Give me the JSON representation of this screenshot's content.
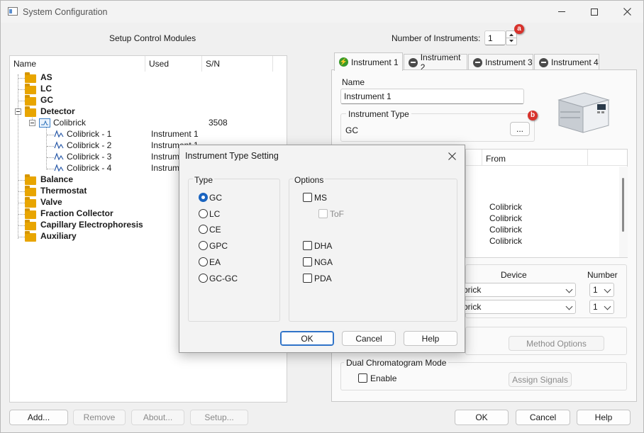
{
  "window": {
    "title": "System Configuration"
  },
  "left": {
    "heading": "Setup Control Modules",
    "columns": [
      "Name",
      "Used",
      "S/N"
    ],
    "tree": [
      {
        "label": "AS",
        "bold": true
      },
      {
        "label": "LC",
        "bold": true
      },
      {
        "label": "GC",
        "bold": true
      },
      {
        "label": "Detector",
        "bold": true
      },
      {
        "label": "Colibrick",
        "sn": "3508"
      },
      {
        "label": "Colibrick - 1",
        "used": "Instrument 1"
      },
      {
        "label": "Colibrick - 2",
        "used": "Instrument 1"
      },
      {
        "label": "Colibrick - 3",
        "used": "Instrume"
      },
      {
        "label": "Colibrick - 4",
        "used": "Instrume"
      },
      {
        "label": "Balance",
        "bold": true
      },
      {
        "label": "Thermostat",
        "bold": true
      },
      {
        "label": "Valve",
        "bold": true
      },
      {
        "label": "Fraction Collector",
        "bold": true
      },
      {
        "label": "Capillary Electrophoresis",
        "bold": true
      },
      {
        "label": "Auxiliary",
        "bold": true
      }
    ],
    "buttons": {
      "add": "Add...",
      "remove": "Remove",
      "about": "About...",
      "setup": "Setup..."
    }
  },
  "right": {
    "num_instruments_label": "Number of Instruments:",
    "num_instruments_value": "1",
    "badge_a": "a",
    "badge_b": "b",
    "tabs": [
      "Instrument 1",
      "Instrument 2",
      "Instrument 3",
      "Instrument 4"
    ],
    "name_label": "Name",
    "name_value": "Instrument 1",
    "instrument_type_label": "Instrument Type",
    "instrument_type_value": "GC",
    "browse_label": "...",
    "from_header": "From",
    "from_values": [
      "Colibrick",
      "Colibrick",
      "Colibrick",
      "Colibrick"
    ],
    "device_header": "Device",
    "number_header": "Number",
    "device_rows": [
      {
        "device": "brick",
        "number": "1"
      },
      {
        "device": "brick",
        "number": "1"
      }
    ],
    "method_options": "Method Options",
    "dual_mode_label": "Dual Chromatogram Mode",
    "enable_label": "Enable",
    "assign_signals": "Assign Signals"
  },
  "footer": {
    "ok": "OK",
    "cancel": "Cancel",
    "help": "Help"
  },
  "dialog": {
    "title": "Instrument Type Setting",
    "type_label": "Type",
    "types": [
      "GC",
      "LC",
      "CE",
      "GPC",
      "EA",
      "GC-GC"
    ],
    "selected_type": "GC",
    "options_label": "Options",
    "options": [
      "MS",
      "ToF",
      "DHA",
      "NGA",
      "PDA"
    ],
    "ok": "OK",
    "cancel": "Cancel",
    "help": "Help"
  },
  "colors": {
    "accent": "#1a64c0",
    "folder": "#e8a500",
    "badge": "#d8322c"
  }
}
